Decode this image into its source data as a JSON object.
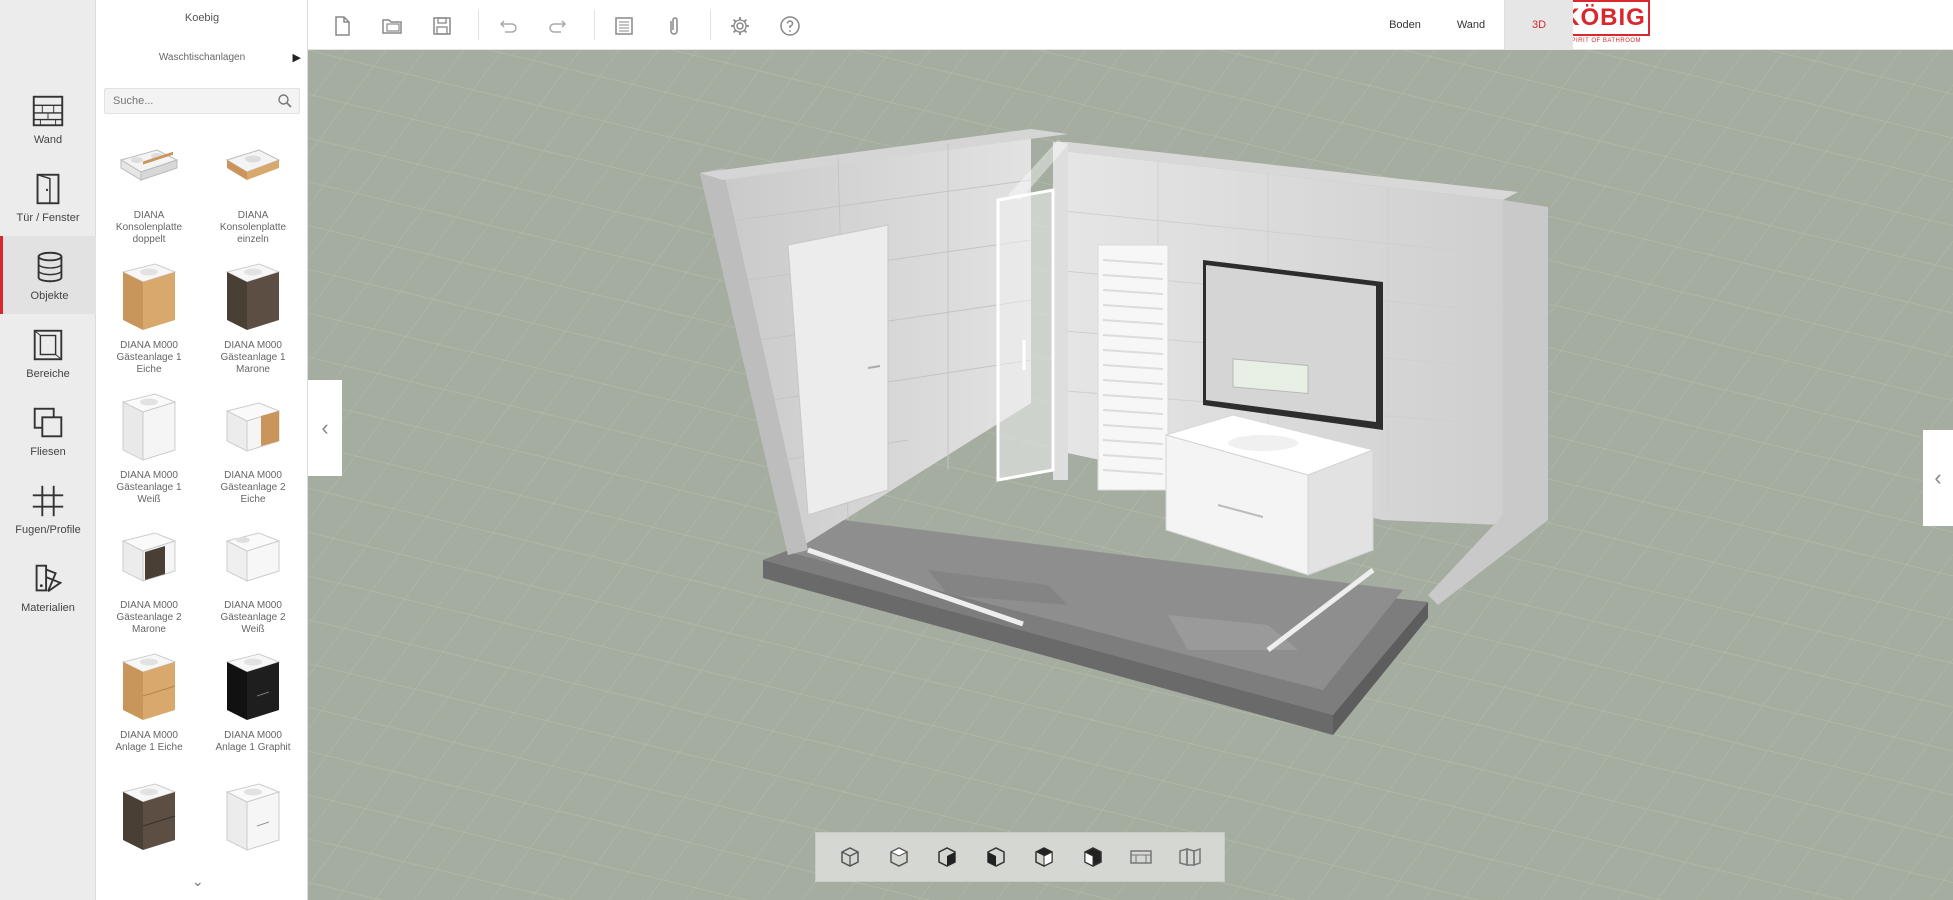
{
  "toolbar": {
    "new_label": "Neu",
    "views": [
      {
        "label": "Boden",
        "active": false
      },
      {
        "label": "Wand",
        "active": false
      },
      {
        "label": "3D",
        "active": true
      }
    ]
  },
  "brand": {
    "name": "KÖBIG",
    "tagline": "SPIRIT OF BATHROOM",
    "color": "#d9272e"
  },
  "rail": {
    "items": [
      {
        "label": "Wand",
        "icon": "wall-icon"
      },
      {
        "label": "Tür / Fenster",
        "icon": "door-window-icon"
      },
      {
        "label": "Objekte",
        "icon": "objects-icon",
        "active": true
      },
      {
        "label": "Bereiche",
        "icon": "areas-icon"
      },
      {
        "label": "Fliesen",
        "icon": "tiles-icon"
      },
      {
        "label": "Fugen/Profile",
        "icon": "grid-icon"
      },
      {
        "label": "Materialien",
        "icon": "materials-icon"
      }
    ]
  },
  "catalog": {
    "title": "Koebig",
    "category": "Waschtischanlagen",
    "search_placeholder": "Suche...",
    "products": [
      {
        "name": "DIANA Konsolenplatte doppelt"
      },
      {
        "name": "DIANA Konsolenplatte einzeln"
      },
      {
        "name": "DIANA M000 Gästeanlage 1 Eiche"
      },
      {
        "name": "DIANA M000 Gästeanlage 1 Marone"
      },
      {
        "name": "DIANA M000 Gästeanlage 1 Weiß"
      },
      {
        "name": "DIANA M000 Gästeanlage 2 Eiche"
      },
      {
        "name": "DIANA M000 Gästeanlage 2 Marone"
      },
      {
        "name": "DIANA M000 Gästeanlage 2 Weiß"
      },
      {
        "name": "DIANA M000 Anlage 1 Eiche"
      },
      {
        "name": "DIANA M000 Anlage 1 Graphit"
      },
      {
        "name": ""
      },
      {
        "name": ""
      }
    ]
  },
  "colors": {
    "accent": "#d9272e",
    "viewport_bg": "#a4ad9f"
  }
}
